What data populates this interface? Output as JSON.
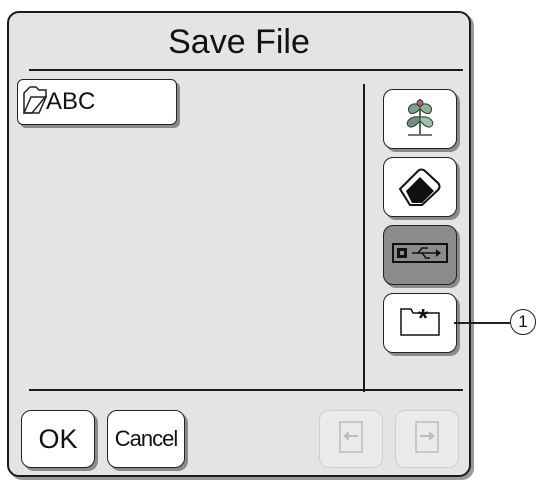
{
  "dialog": {
    "title": "Save File",
    "folder": {
      "label": "ABC",
      "icon": "folder-icon"
    },
    "side_buttons": [
      {
        "icon": "embroidery-pattern-icon"
      },
      {
        "icon": "eraser-icon"
      },
      {
        "icon": "usb-media-icon",
        "active": true
      },
      {
        "icon": "new-folder-icon"
      }
    ],
    "ok_label": "OK",
    "cancel_label": "Cancel",
    "nav": {
      "prev_icon": "page-prev-arrow-icon",
      "next_icon": "page-next-arrow-icon"
    }
  },
  "callout": {
    "number": "1"
  }
}
